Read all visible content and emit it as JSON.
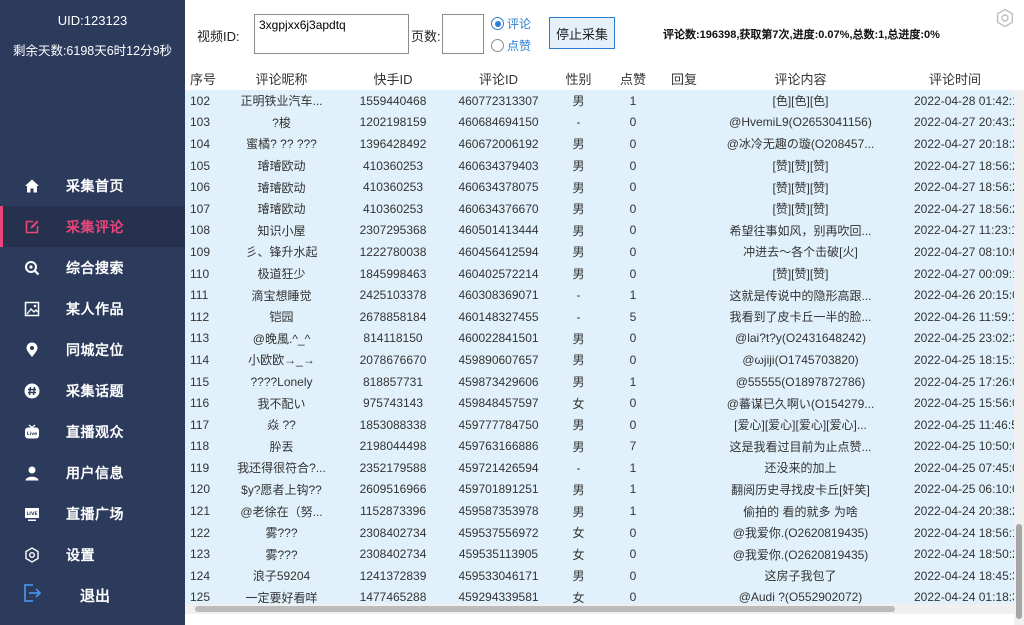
{
  "sidebar": {
    "uid": "UID:123123",
    "remaining": "剩余天数:6198天6时12分9秒",
    "items": [
      {
        "label": "采集首页",
        "icon": "home-icon"
      },
      {
        "label": "采集评论",
        "icon": "edit-icon"
      },
      {
        "label": "综合搜索",
        "icon": "search-icon"
      },
      {
        "label": "某人作品",
        "icon": "image-icon"
      },
      {
        "label": "同城定位",
        "icon": "location-icon"
      },
      {
        "label": "采集话题",
        "icon": "hashtag-icon"
      },
      {
        "label": "直播观众",
        "icon": "live-tv-icon"
      },
      {
        "label": "用户信息",
        "icon": "user-icon"
      },
      {
        "label": "直播广场",
        "icon": "live-square-icon"
      },
      {
        "label": "设置",
        "icon": "gear-icon"
      }
    ],
    "active_index": 1,
    "logout_label": "退出",
    "colors": {
      "background": "#2c3a5c",
      "accent": "#e9457a"
    }
  },
  "toolbar": {
    "video_label": "视频ID:",
    "video_value": "3xgpjxx6j3apdtq",
    "page_label": "页数:",
    "page_value": "",
    "radio_comment": "评论",
    "radio_like": "点赞",
    "selected": "评论",
    "stop_label": "停止采集",
    "status": "评论数:196398,获取第7次,进度:0.07%,总数:1,总进度:0%"
  },
  "table": {
    "columns": [
      "序号",
      "评论昵称",
      "快手ID",
      "评论ID",
      "性别",
      "点赞",
      "回复",
      "评论内容",
      "评论时间"
    ],
    "rows": [
      [
        "102",
        "正明铁业汽车...",
        "1559440468",
        "460772313307",
        "男",
        "1",
        "",
        "[色][色][色]",
        "2022-04-28 01:42:14"
      ],
      [
        "103",
        "?梭",
        "1202198159",
        "460684694150",
        "-",
        "0",
        "",
        "@HvemiL9(O2653041156)",
        "2022-04-27 20:43:20"
      ],
      [
        "104",
        "蜜橘? ?? ???",
        "1396428492",
        "460672006192",
        "男",
        "0",
        "",
        "@冰冷无趣の璇(O208457...",
        "2022-04-27 20:18:21"
      ],
      [
        "105",
        "璿璿欧动",
        "410360253",
        "460634379403",
        "男",
        "0",
        "",
        "[赞][赞][赞]",
        "2022-04-27 18:56:28"
      ],
      [
        "106",
        "璿璿欧动",
        "410360253",
        "460634378075",
        "男",
        "0",
        "",
        "[赞][赞][赞]",
        "2022-04-27 18:56:28"
      ],
      [
        "107",
        "璿璿欧动",
        "410360253",
        "460634376670",
        "男",
        "0",
        "",
        "[赞][赞][赞]",
        "2022-04-27 18:56:28"
      ],
      [
        "108",
        "知识小屋",
        "2307295368",
        "460501413444",
        "男",
        "0",
        "",
        "希望往事如风，别再吹回...",
        "2022-04-27 11:23:11"
      ],
      [
        "109",
        "彡、锋升水起",
        "1222780038",
        "460456412594",
        "男",
        "0",
        "",
        "冲进去～各个击破[火]",
        "2022-04-27 08:10:03"
      ],
      [
        "110",
        "极道狂少",
        "1845998463",
        "460402572214",
        "男",
        "0",
        "",
        "[赞][赞][赞]",
        "2022-04-27 00:09:15"
      ],
      [
        "111",
        "滴宝想睡觉",
        "2425103378",
        "460308369071",
        "-",
        "1",
        "",
        "这就是传说中的隐形高跟...",
        "2022-04-26 20:15:04"
      ],
      [
        "112",
        "铠园",
        "2678858184",
        "460148327455",
        "-",
        "5",
        "",
        "我看到了皮卡丘一半的脸...",
        "2022-04-26 11:59:16"
      ],
      [
        "113",
        "@晚風.^_^",
        "814118150",
        "460022841501",
        "男",
        "0",
        "",
        "@lai?t?y(O2431648242)",
        "2022-04-25 23:02:34"
      ],
      [
        "114",
        "小欧欧→_→",
        "2078676670",
        "459890607657",
        "男",
        "0",
        "",
        "@ωjiji(O1745703820)",
        "2022-04-25 18:15:19"
      ],
      [
        "115",
        "????Lonely",
        "818857731",
        "459873429606",
        "男",
        "1",
        "",
        "@55555(O1897872786)",
        "2022-04-25 17:26:04"
      ],
      [
        "116",
        "我不配い",
        "975743143",
        "459848457597",
        "女",
        "0",
        "",
        "@蕃谋已久啊い(O154279...",
        "2022-04-25 15:56:07"
      ],
      [
        "117",
        "焱 ??",
        "1853088338",
        "459777784750",
        "男",
        "0",
        "",
        "[爱心][爱心][爱心][爱心]...",
        "2022-04-25 11:46:56"
      ],
      [
        "118",
        "肸丟",
        "2198044498",
        "459763166886",
        "男",
        "7",
        "",
        "这是我看过目前为止点赞...",
        "2022-04-25 10:50:03"
      ],
      [
        "119",
        "我还得很符合?...",
        "2352179588",
        "459721426594",
        "-",
        "1",
        "",
        "还没来的加上",
        "2022-04-25 07:45:06"
      ],
      [
        "120",
        "$y?愿者上钩??",
        "2609516966",
        "459701891251",
        "男",
        "1",
        "",
        "翻阅历史寻找皮卡丘[奸笑]",
        "2022-04-25 06:10:07"
      ],
      [
        "121",
        "@老徐在（努...",
        "1152873396",
        "459587353978",
        "男",
        "1",
        "",
        "偷拍的  看的就多  为啥",
        "2022-04-24 20:38:26"
      ],
      [
        "122",
        "雾???",
        "2308402734",
        "459537556972",
        "女",
        "0",
        "",
        "@我爱你.(O2620819435)",
        "2022-04-24 18:56:10"
      ],
      [
        "123",
        "雾???",
        "2308402734",
        "459535113905",
        "女",
        "0",
        "",
        "@我爱你.(O2620819435)",
        "2022-04-24 18:50:26"
      ],
      [
        "124",
        "浪子59204",
        "1241372839",
        "459533046171",
        "男",
        "0",
        "",
        "这房子我包了",
        "2022-04-24 18:45:30"
      ],
      [
        "125",
        "一定要好看咩",
        "1477465288",
        "459294339581",
        "女",
        "0",
        "",
        "@Audi ?(O552902072)",
        "2022-04-24 01:18:37"
      ]
    ]
  }
}
